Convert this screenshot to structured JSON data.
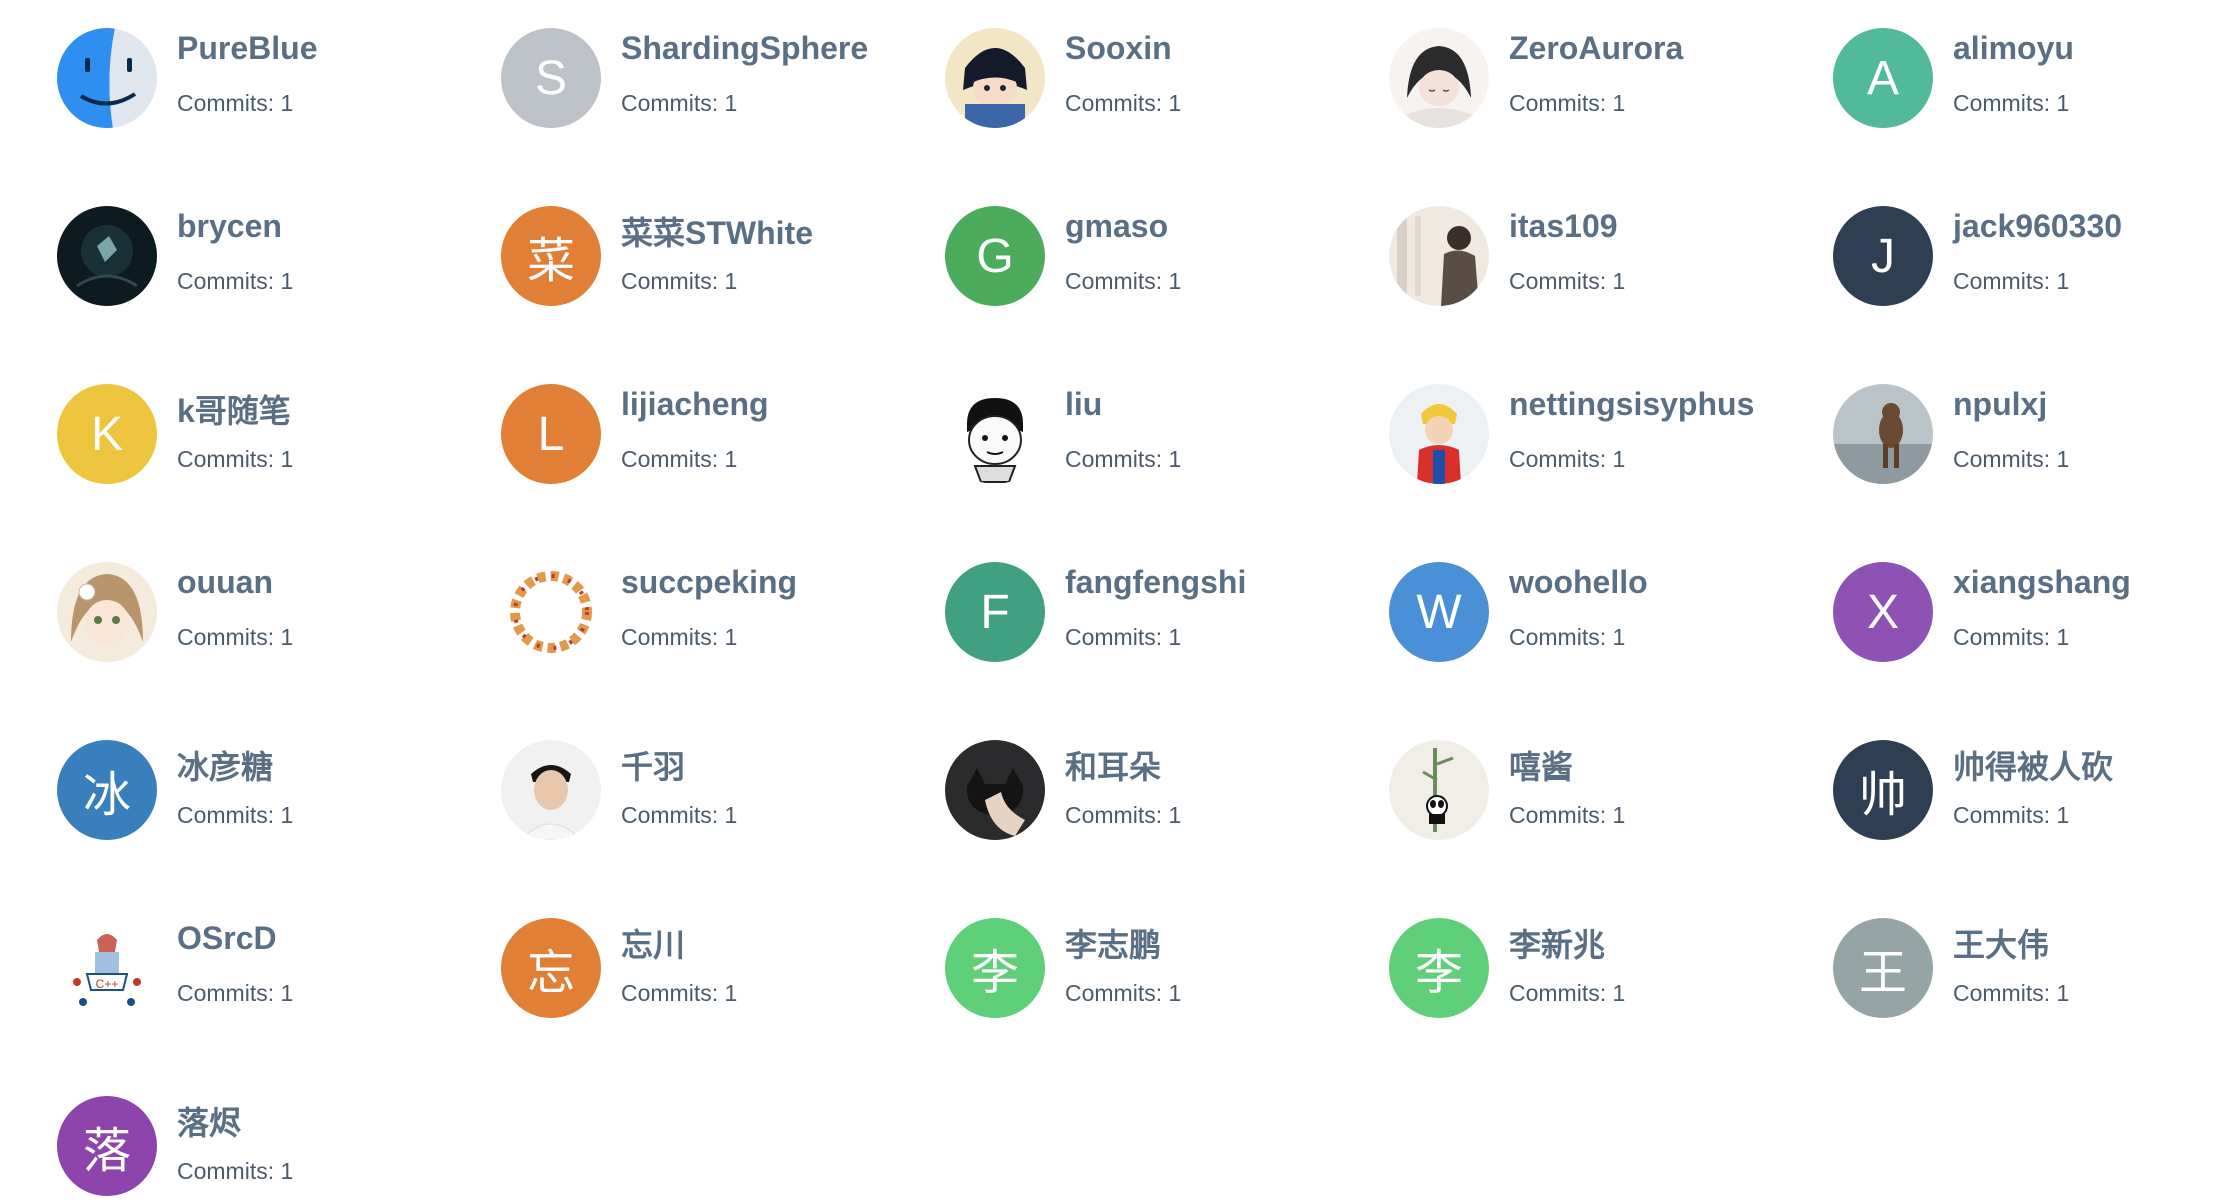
{
  "contributors": [
    {
      "name": "PureBlue",
      "commits_label": "Commits: 1",
      "avatar_type": "image",
      "icon": "finder-face-icon"
    },
    {
      "name": "ShardingSphere",
      "commits_label": "Commits: 1",
      "avatar_type": "letter",
      "letter": "S",
      "color": "#bcc2c7"
    },
    {
      "name": "Sooxin",
      "commits_label": "Commits: 1",
      "avatar_type": "image",
      "icon": "anime-boy-icon"
    },
    {
      "name": "ZeroAurora",
      "commits_label": "Commits: 1",
      "avatar_type": "image",
      "icon": "anime-girl-sketch-icon"
    },
    {
      "name": "alimoyu",
      "commits_label": "Commits: 1",
      "avatar_type": "letter",
      "letter": "A",
      "color": "#52b99a"
    },
    {
      "name": "brycen",
      "commits_label": "Commits: 1",
      "avatar_type": "image",
      "icon": "dark-night-scene-icon"
    },
    {
      "name": "菜菜STWhite",
      "commits_label": "Commits: 1",
      "avatar_type": "letter",
      "letter": "菜",
      "color": "#e07f35"
    },
    {
      "name": "gmaso",
      "commits_label": "Commits: 1",
      "avatar_type": "letter",
      "letter": "G",
      "color": "#4cac5b"
    },
    {
      "name": "itas109",
      "commits_label": "Commits: 1",
      "avatar_type": "image",
      "icon": "person-by-window-icon"
    },
    {
      "name": "jack960330",
      "commits_label": "Commits: 1",
      "avatar_type": "letter",
      "letter": "J",
      "color": "#2f3f53"
    },
    {
      "name": "k哥随笔",
      "commits_label": "Commits: 1",
      "avatar_type": "letter",
      "letter": "K",
      "color": "#ecc43d"
    },
    {
      "name": "lijiacheng",
      "commits_label": "Commits: 1",
      "avatar_type": "letter",
      "letter": "L",
      "color": "#e07f35"
    },
    {
      "name": "liu",
      "commits_label": "Commits: 1",
      "avatar_type": "image",
      "icon": "meme-face-icon"
    },
    {
      "name": "nettingsisyphus",
      "commits_label": "Commits: 1",
      "avatar_type": "image",
      "icon": "cartoon-person-red-icon"
    },
    {
      "name": "npulxj",
      "commits_label": "Commits: 1",
      "avatar_type": "image",
      "icon": "bear-photo-icon"
    },
    {
      "name": "ouuan",
      "commits_label": "Commits: 1",
      "avatar_type": "image",
      "icon": "anime-girl-beige-icon"
    },
    {
      "name": "succpeking",
      "commits_label": "Commits: 1",
      "avatar_type": "image",
      "icon": "flower-wreath-icon"
    },
    {
      "name": "fangfengshi",
      "commits_label": "Commits: 1",
      "avatar_type": "letter",
      "letter": "F",
      "color": "#42a082"
    },
    {
      "name": "woohello",
      "commits_label": "Commits: 1",
      "avatar_type": "letter",
      "letter": "W",
      "color": "#4a90d6"
    },
    {
      "name": "xiangshang",
      "commits_label": "Commits: 1",
      "avatar_type": "letter",
      "letter": "X",
      "color": "#8e52b5"
    },
    {
      "name": "冰彦糖",
      "commits_label": "Commits: 1",
      "avatar_type": "letter",
      "letter": "冰",
      "color": "#3a7fbd"
    },
    {
      "name": "千羽",
      "commits_label": "Commits: 1",
      "avatar_type": "image",
      "icon": "man-portrait-icon"
    },
    {
      "name": "和耳朵",
      "commits_label": "Commits: 1",
      "avatar_type": "image",
      "icon": "dark-cat-photo-icon"
    },
    {
      "name": "嘻酱",
      "commits_label": "Commits: 1",
      "avatar_type": "image",
      "icon": "panda-bamboo-icon"
    },
    {
      "name": "帅得被人砍",
      "commits_label": "Commits: 1",
      "avatar_type": "letter",
      "letter": "帅",
      "color": "#2f3f53"
    },
    {
      "name": "OSrcD",
      "commits_label": "Commits: 1",
      "avatar_type": "image",
      "icon": "cpp-logo-icon"
    },
    {
      "name": "忘川",
      "commits_label": "Commits: 1",
      "avatar_type": "letter",
      "letter": "忘",
      "color": "#e07f35"
    },
    {
      "name": "李志鹏",
      "commits_label": "Commits: 1",
      "avatar_type": "letter",
      "letter": "李",
      "color": "#5fcf7a"
    },
    {
      "name": "李新兆",
      "commits_label": "Commits: 1",
      "avatar_type": "letter",
      "letter": "李",
      "color": "#5fcf7a"
    },
    {
      "name": "王大伟",
      "commits_label": "Commits: 1",
      "avatar_type": "letter",
      "letter": "王",
      "color": "#95a5a6"
    },
    {
      "name": "落烬",
      "commits_label": "Commits: 1",
      "avatar_type": "letter",
      "letter": "落",
      "color": "#8e44ad"
    }
  ]
}
